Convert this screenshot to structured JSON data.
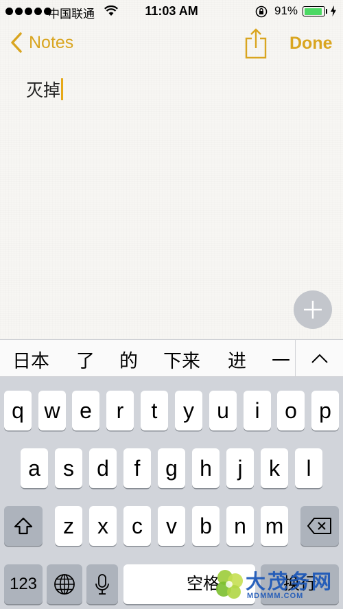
{
  "status_bar": {
    "carrier": "中国联通",
    "time": "11:03 AM",
    "battery_percent": "91%",
    "battery_level": 0.91,
    "battery_color": "#4cd964"
  },
  "nav": {
    "back_label": "Notes",
    "back_icon": "chevron-left-icon",
    "share_icon": "share-icon",
    "done_label": "Done",
    "accent_color": "#d9a520"
  },
  "note": {
    "text": "灭掉"
  },
  "fab": {
    "icon": "plus-icon"
  },
  "candidates": [
    "日本",
    "了",
    "的",
    "下来",
    "进",
    "一"
  ],
  "keyboard": {
    "row1": [
      "q",
      "w",
      "e",
      "r",
      "t",
      "y",
      "u",
      "i",
      "o",
      "p"
    ],
    "row2": [
      "a",
      "s",
      "d",
      "f",
      "g",
      "h",
      "j",
      "k",
      "l"
    ],
    "row3": [
      "z",
      "x",
      "c",
      "v",
      "b",
      "n",
      "m"
    ],
    "numbers_label": "123",
    "space_label": "空格",
    "return_label": "换行"
  },
  "watermark": {
    "brand": "大茂务网",
    "url": "MDMMM.COM"
  }
}
